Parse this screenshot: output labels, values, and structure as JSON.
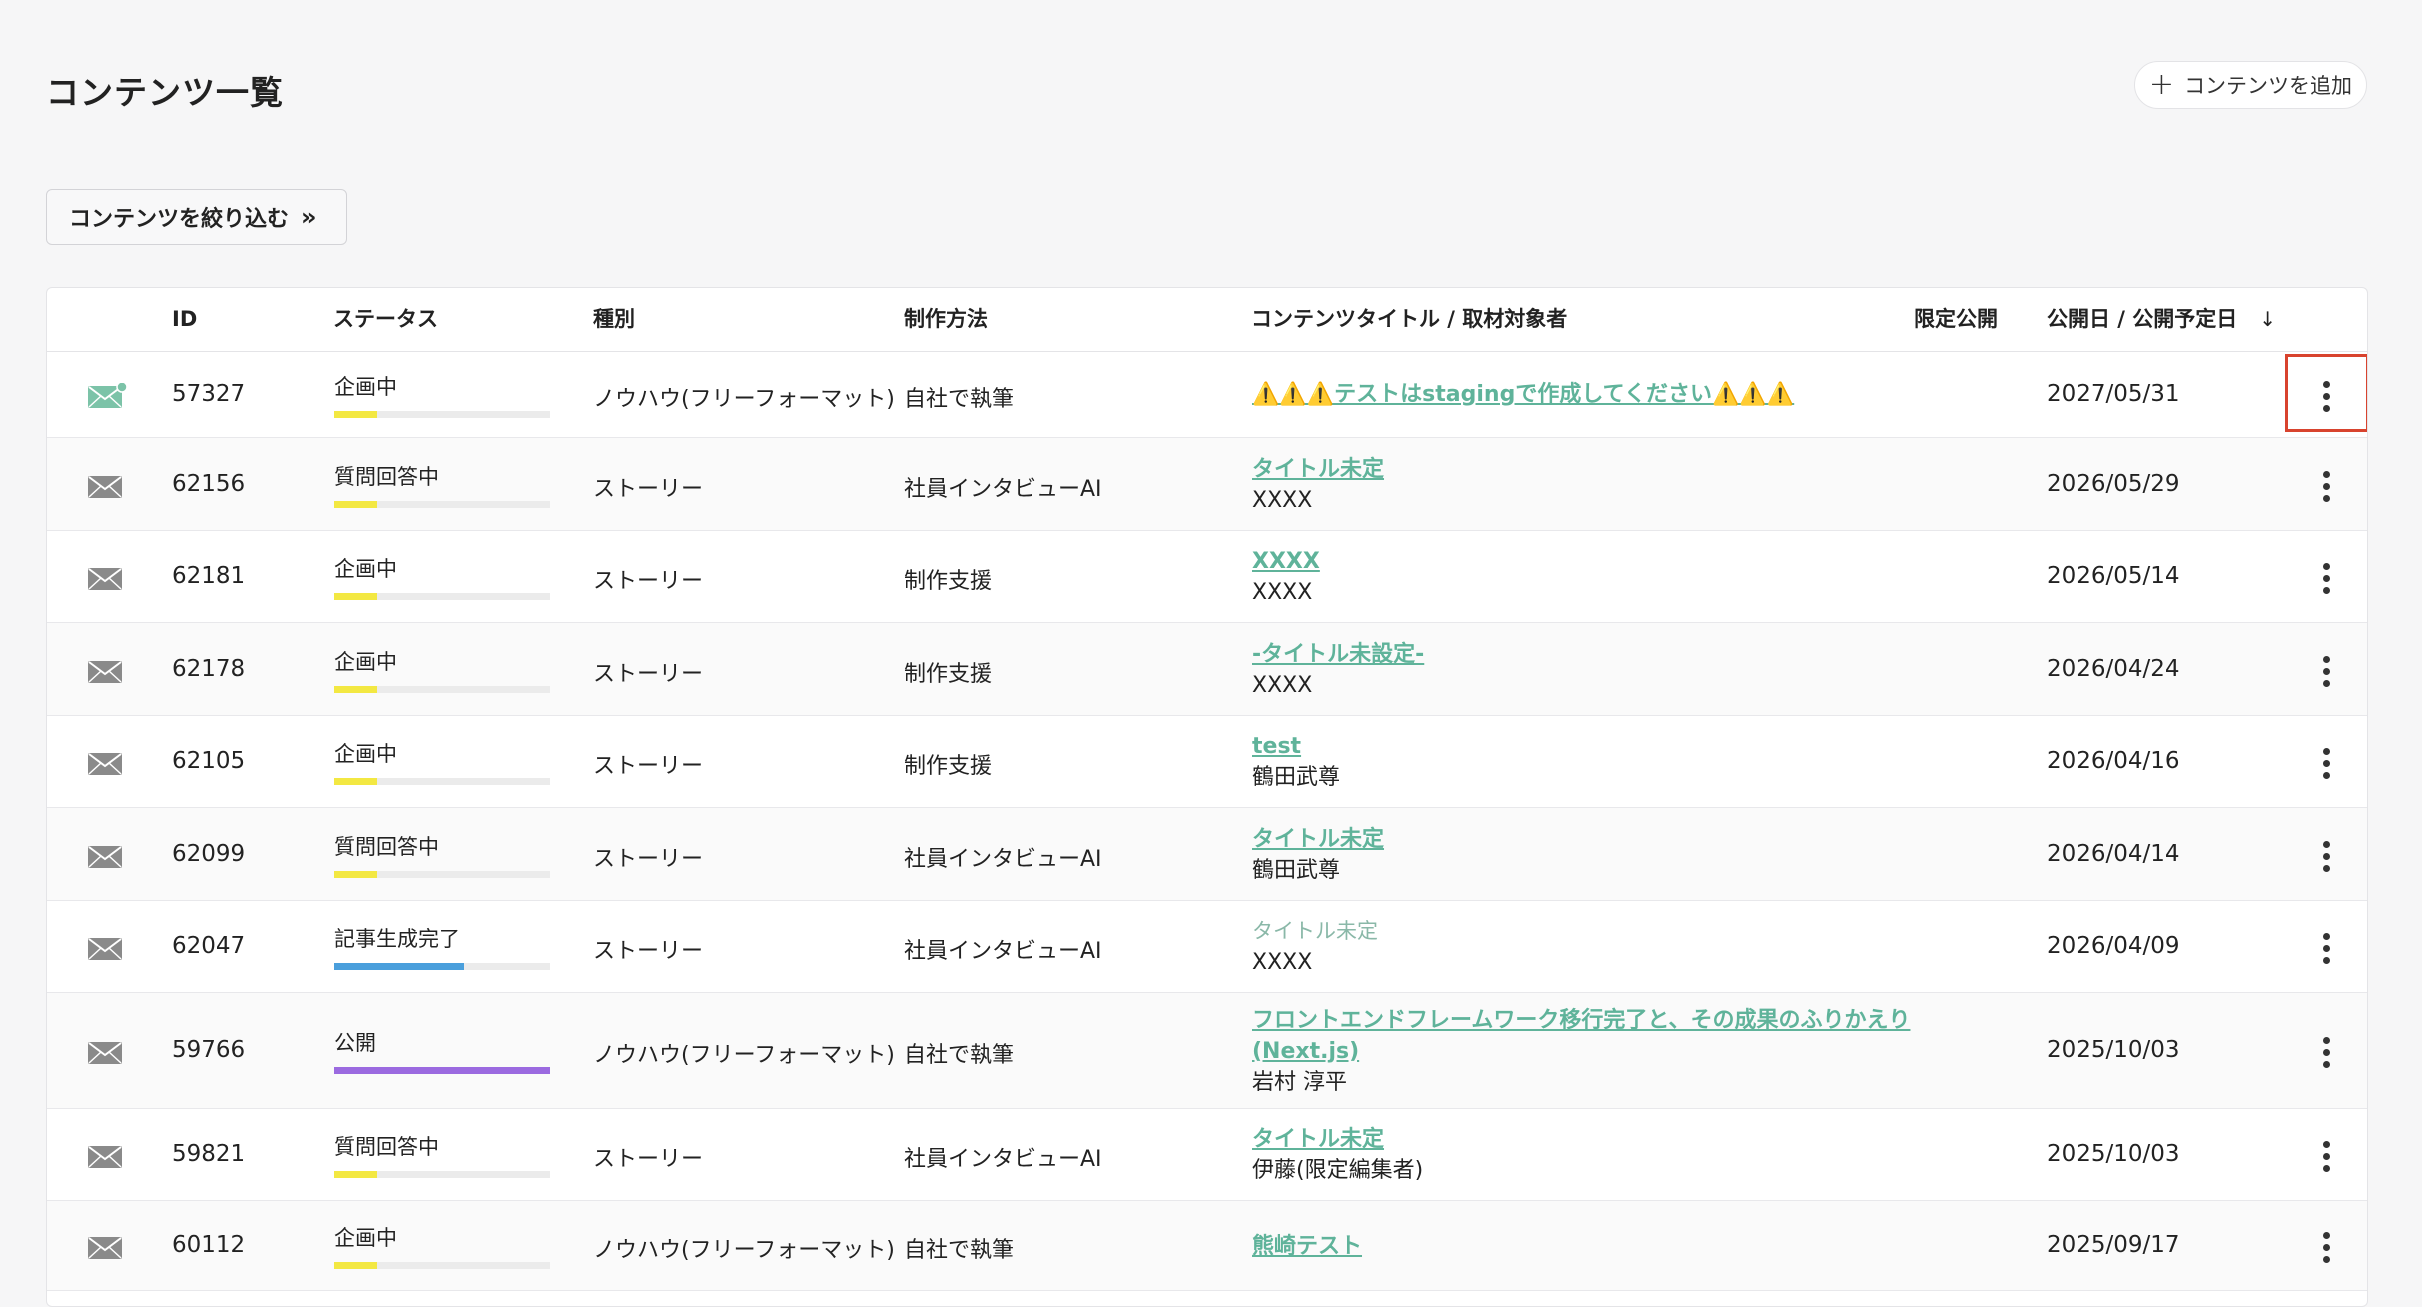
{
  "page": {
    "title": "コンテンツ一覧",
    "add_button_label": "コンテンツを追加",
    "filter_button_label": "コンテンツを絞り込む"
  },
  "colors": {
    "accent_link": "#5fb39a",
    "status_planning": "#f3e842",
    "status_generated": "#4a9fdc",
    "status_published": "#9b6ae0",
    "highlight": "#d8432e"
  },
  "table": {
    "headers": {
      "id": "ID",
      "status": "ステータス",
      "type": "種別",
      "method": "制作方法",
      "title": "コンテンツタイトル / 取材対象者",
      "limited": "限定公開",
      "date": "公開日 / 公開予定日"
    },
    "rows": [
      {
        "id": "57327",
        "status": "企画中",
        "status_progress": 0.2,
        "status_color": "#f3e842",
        "type": "ノウハウ(フリーフォーマット)",
        "method": "自社で執筆",
        "title": "⚠️⚠️⚠️テストはstagingで作成してください⚠️⚠️⚠️",
        "title_linked": true,
        "subject": "",
        "date": "2027/05/31",
        "mail_icon": "mail-unread-icon"
      },
      {
        "id": "62156",
        "status": "質問回答中",
        "status_progress": 0.2,
        "status_color": "#f3e842",
        "type": "ストーリー",
        "method": "社員インタビューAI",
        "title": "タイトル未定",
        "title_linked": true,
        "subject": "XXXX",
        "date": "2026/05/29",
        "mail_icon": "mail-icon"
      },
      {
        "id": "62181",
        "status": "企画中",
        "status_progress": 0.2,
        "status_color": "#f3e842",
        "type": "ストーリー",
        "method": "制作支援",
        "title": "XXXX",
        "title_linked": true,
        "subject": "XXXX",
        "date": "2026/05/14",
        "mail_icon": "mail-icon"
      },
      {
        "id": "62178",
        "status": "企画中",
        "status_progress": 0.2,
        "status_color": "#f3e842",
        "type": "ストーリー",
        "method": "制作支援",
        "title": "-タイトル未設定-",
        "title_linked": true,
        "subject": "XXXX",
        "date": "2026/04/24",
        "mail_icon": "mail-icon"
      },
      {
        "id": "62105",
        "status": "企画中",
        "status_progress": 0.2,
        "status_color": "#f3e842",
        "type": "ストーリー",
        "method": "制作支援",
        "title": "test",
        "title_linked": true,
        "subject": "鶴田武尊",
        "date": "2026/04/16",
        "mail_icon": "mail-icon"
      },
      {
        "id": "62099",
        "status": "質問回答中",
        "status_progress": 0.2,
        "status_color": "#f3e842",
        "type": "ストーリー",
        "method": "社員インタビューAI",
        "title": "タイトル未定",
        "title_linked": true,
        "subject": "鶴田武尊",
        "date": "2026/04/14",
        "mail_icon": "mail-icon"
      },
      {
        "id": "62047",
        "status": "記事生成完了",
        "status_progress": 0.6,
        "status_color": "#4a9fdc",
        "type": "ストーリー",
        "method": "社員インタビューAI",
        "title": "タイトル未定",
        "title_linked": false,
        "subject": "XXXX",
        "date": "2026/04/09",
        "mail_icon": "mail-icon"
      },
      {
        "id": "59766",
        "status": "公開",
        "status_progress": 1.0,
        "status_color": "#9b6ae0",
        "type": "ノウハウ(フリーフォーマット)",
        "method": "自社で執筆",
        "title": "フロントエンドフレームワーク移行完了と、その成果のふりかえり",
        "title2": "(Next.js)",
        "title_linked": true,
        "subject": "岩村 淳平",
        "date": "2025/10/03",
        "mail_icon": "mail-icon"
      },
      {
        "id": "59821",
        "status": "質問回答中",
        "status_progress": 0.2,
        "status_color": "#f3e842",
        "type": "ストーリー",
        "method": "社員インタビューAI",
        "title": "タイトル未定",
        "title_linked": true,
        "subject": "伊藤(限定編集者)",
        "date": "2025/10/03",
        "mail_icon": "mail-icon"
      },
      {
        "id": "60112",
        "status": "企画中",
        "status_progress": 0.2,
        "status_color": "#f3e842",
        "type": "ノウハウ(フリーフォーマット)",
        "method": "自社で執筆",
        "title": "熊崎テスト",
        "title_linked": true,
        "subject": "",
        "date": "2025/09/17",
        "mail_icon": "mail-icon"
      }
    ]
  }
}
